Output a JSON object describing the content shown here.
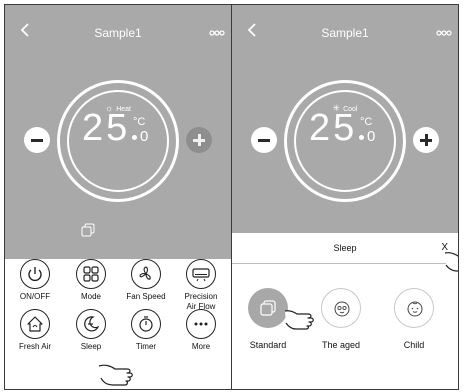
{
  "left_screen": {
    "title": "Sample1",
    "mode_label": "Heat",
    "temp_whole": "25",
    "temp_unit": "°C",
    "temp_decimal": "0",
    "functions": [
      {
        "label": "ON/OFF"
      },
      {
        "label": "Mode"
      },
      {
        "label": "Fan Speed"
      },
      {
        "label": "Precision\nAir Flow"
      },
      {
        "label": "Fresh Air"
      },
      {
        "label": "Sleep"
      },
      {
        "label": "Timer"
      },
      {
        "label": "More"
      }
    ]
  },
  "right_screen": {
    "title": "Sample1",
    "mode_label": "Cool",
    "temp_whole": "25",
    "temp_unit": "°C",
    "temp_decimal": "0",
    "sleep_panel": {
      "title": "Sleep",
      "close_label": "X",
      "options": [
        {
          "label": "Standard",
          "selected": true
        },
        {
          "label": "The aged",
          "selected": false
        },
        {
          "label": "Child",
          "selected": false
        }
      ]
    }
  },
  "colors": {
    "panel_gray": "#a9a9a9",
    "text_dark": "#111111",
    "white": "#ffffff"
  }
}
